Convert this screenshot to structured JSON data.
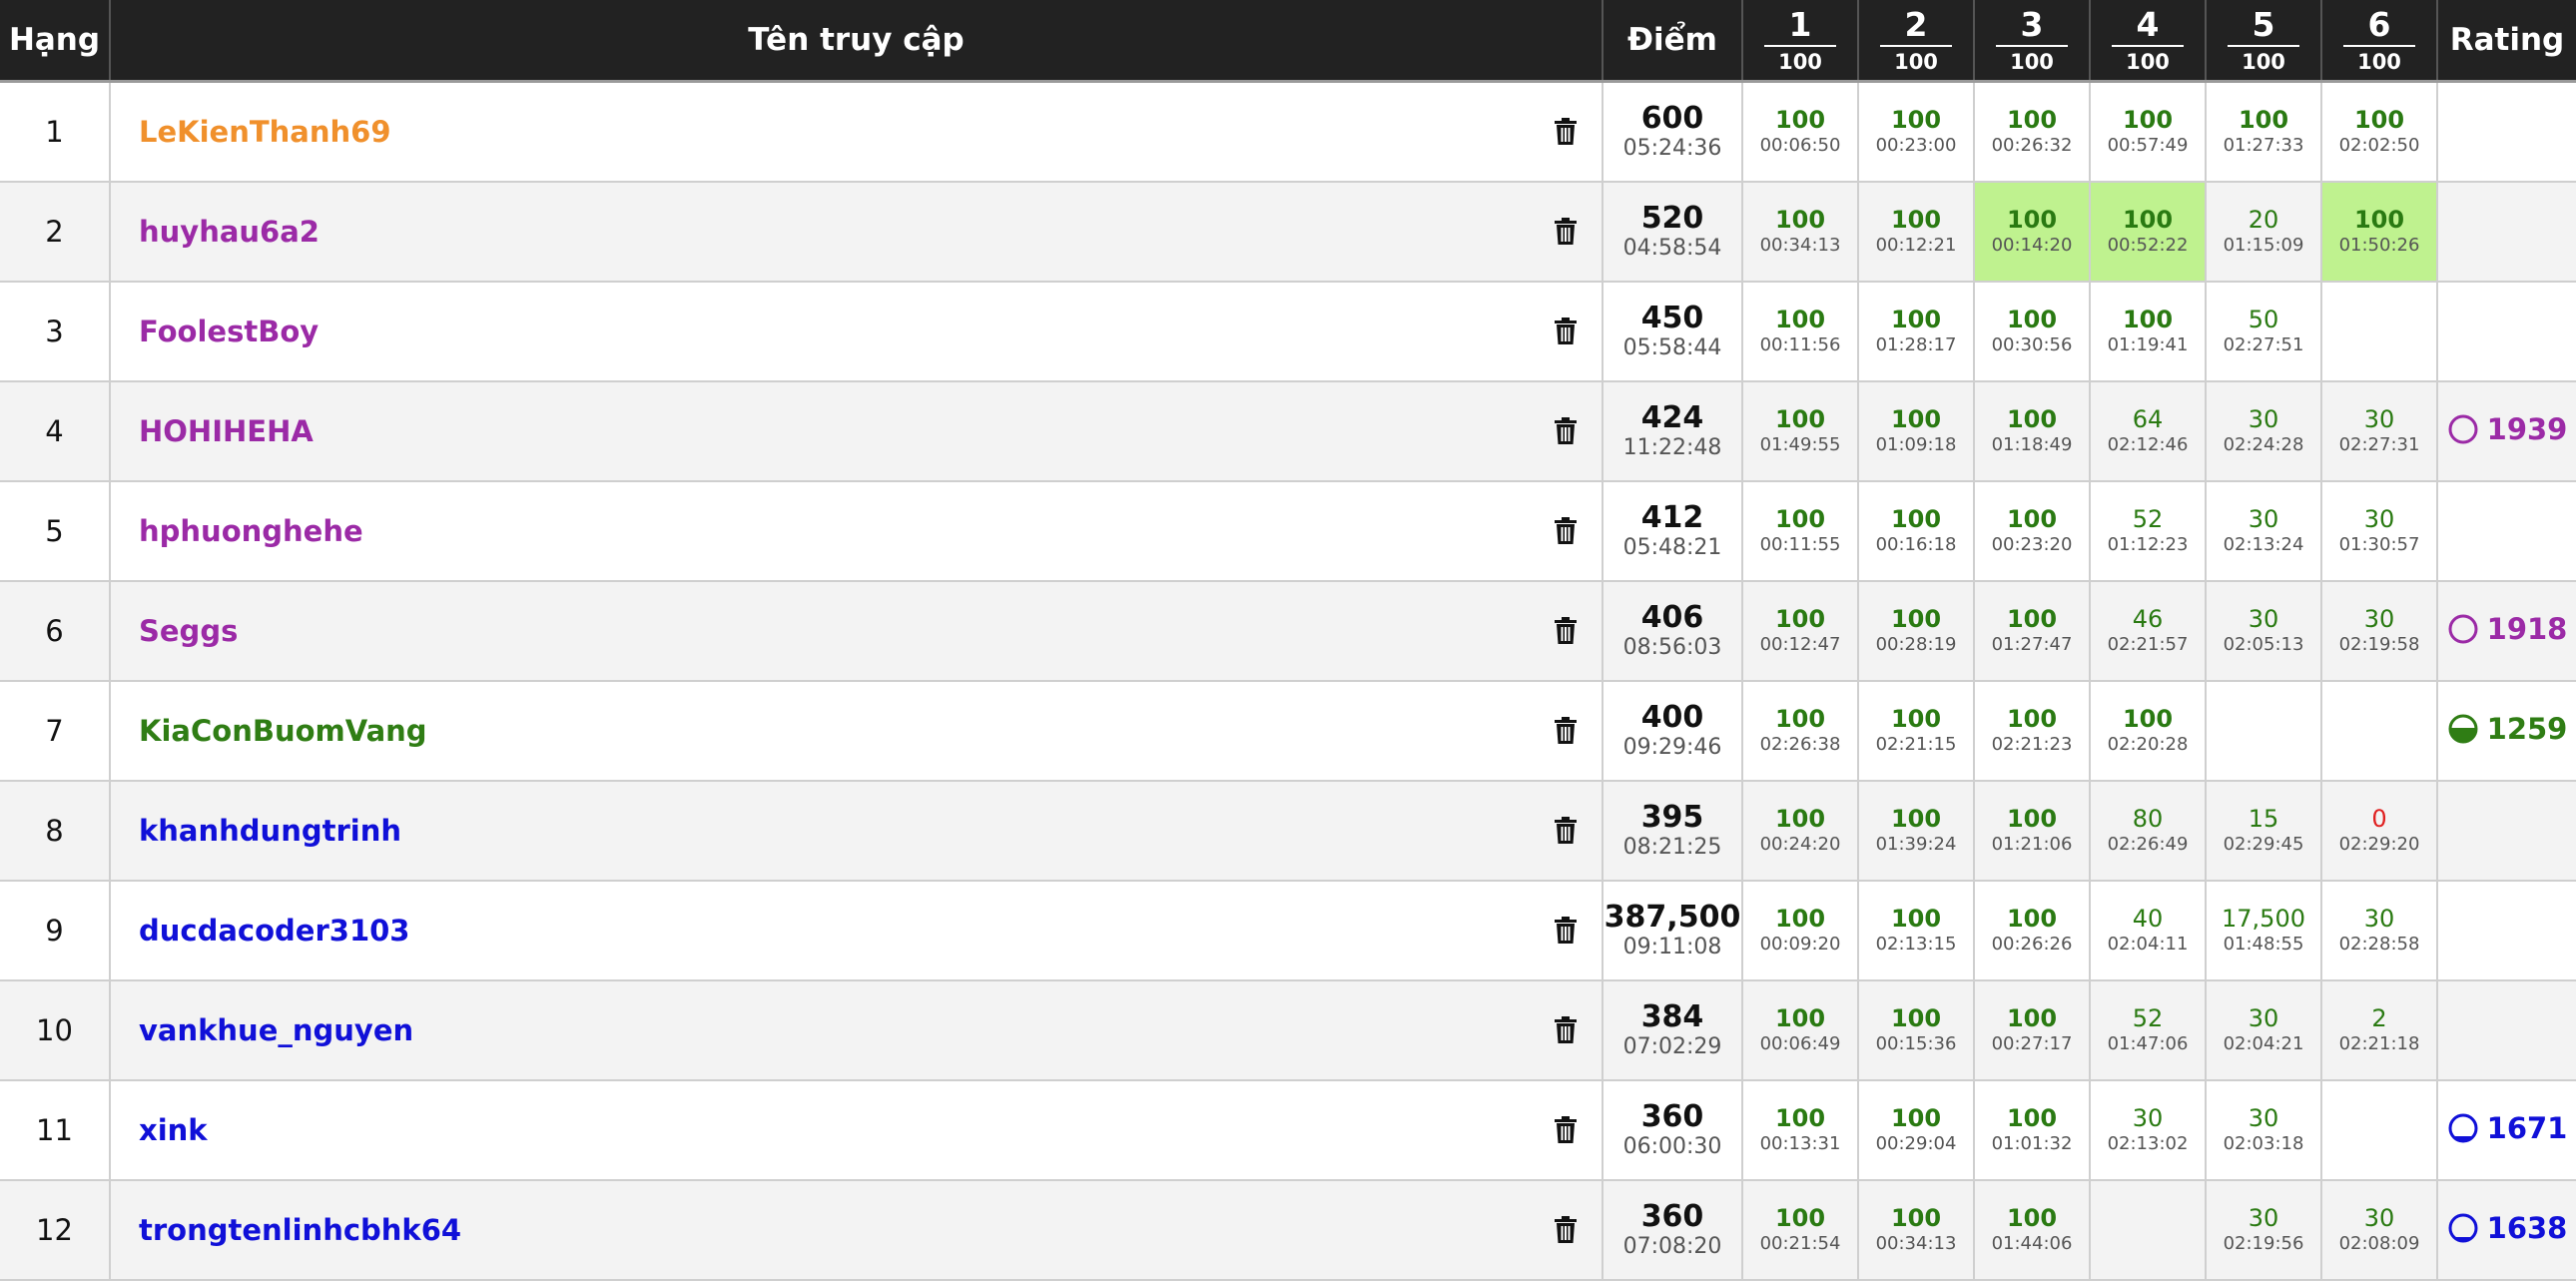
{
  "header": {
    "rank": "Hạng",
    "username": "Tên truy cập",
    "score": "Điểm",
    "rating": "Rating",
    "problems": [
      {
        "num": "1",
        "max": "100"
      },
      {
        "num": "2",
        "max": "100"
      },
      {
        "num": "3",
        "max": "100"
      },
      {
        "num": "4",
        "max": "100"
      },
      {
        "num": "5",
        "max": "100"
      },
      {
        "num": "6",
        "max": "100"
      }
    ]
  },
  "colors": {
    "header_bg": "#222222",
    "full_score": "#2a7a12",
    "zero_score": "#e02020",
    "first_solve_bg": "#bff28f",
    "user_orange": "#f0902c",
    "user_purple": "#9b2aa6",
    "user_green": "#2f7d14",
    "user_blue": "#1010d8",
    "row_alt_bg": "#f3f3f3"
  },
  "icons": {
    "delete": "trash-icon",
    "rating": "rating-circle-icon"
  },
  "rows": [
    {
      "rank": "1",
      "user": "LeKienThanh69",
      "user_color": "#f0902c",
      "points": "600",
      "time": "05:24:36",
      "problems": [
        {
          "s": "100",
          "t": "00:06:50"
        },
        {
          "s": "100",
          "t": "00:23:00"
        },
        {
          "s": "100",
          "t": "00:26:32"
        },
        {
          "s": "100",
          "t": "00:57:49"
        },
        {
          "s": "100",
          "t": "01:27:33"
        },
        {
          "s": "100",
          "t": "02:02:50"
        }
      ],
      "rating": null
    },
    {
      "rank": "2",
      "user": "huyhau6a2",
      "user_color": "#9b2aa6",
      "points": "520",
      "time": "04:58:54",
      "problems": [
        {
          "s": "100",
          "t": "00:34:13"
        },
        {
          "s": "100",
          "t": "00:12:21"
        },
        {
          "s": "100",
          "t": "00:14:20",
          "first": true
        },
        {
          "s": "100",
          "t": "00:52:22",
          "first": true
        },
        {
          "s": "20",
          "t": "01:15:09"
        },
        {
          "s": "100",
          "t": "01:50:26",
          "first": true
        }
      ],
      "rating": null
    },
    {
      "rank": "3",
      "user": "FoolestBoy",
      "user_color": "#9b2aa6",
      "points": "450",
      "time": "05:58:44",
      "problems": [
        {
          "s": "100",
          "t": "00:11:56"
        },
        {
          "s": "100",
          "t": "01:28:17"
        },
        {
          "s": "100",
          "t": "00:30:56"
        },
        {
          "s": "100",
          "t": "01:19:41"
        },
        {
          "s": "50",
          "t": "02:27:51"
        },
        null
      ],
      "rating": null
    },
    {
      "rank": "4",
      "user": "HOHIHEHA",
      "user_color": "#9b2aa6",
      "points": "424",
      "time": "11:22:48",
      "problems": [
        {
          "s": "100",
          "t": "01:49:55"
        },
        {
          "s": "100",
          "t": "01:09:18"
        },
        {
          "s": "100",
          "t": "01:18:49"
        },
        {
          "s": "64",
          "t": "02:12:46"
        },
        {
          "s": "30",
          "t": "02:24:28"
        },
        {
          "s": "30",
          "t": "02:27:31"
        }
      ],
      "rating": {
        "value": "1939",
        "color": "#9b2aa6",
        "fill": 0.05
      }
    },
    {
      "rank": "5",
      "user": "hphuonghehe",
      "user_color": "#9b2aa6",
      "points": "412",
      "time": "05:48:21",
      "problems": [
        {
          "s": "100",
          "t": "00:11:55"
        },
        {
          "s": "100",
          "t": "00:16:18"
        },
        {
          "s": "100",
          "t": "00:23:20"
        },
        {
          "s": "52",
          "t": "01:12:23"
        },
        {
          "s": "30",
          "t": "02:13:24"
        },
        {
          "s": "30",
          "t": "01:30:57"
        }
      ],
      "rating": null
    },
    {
      "rank": "6",
      "user": "Seggs",
      "user_color": "#9b2aa6",
      "points": "406",
      "time": "08:56:03",
      "problems": [
        {
          "s": "100",
          "t": "00:12:47"
        },
        {
          "s": "100",
          "t": "00:28:19"
        },
        {
          "s": "100",
          "t": "01:27:47"
        },
        {
          "s": "46",
          "t": "02:21:57"
        },
        {
          "s": "30",
          "t": "02:05:13"
        },
        {
          "s": "30",
          "t": "02:19:58"
        }
      ],
      "rating": {
        "value": "1918",
        "color": "#9b2aa6",
        "fill": 0.03
      }
    },
    {
      "rank": "7",
      "user": "KiaConBuomVang",
      "user_color": "#2f7d14",
      "points": "400",
      "time": "09:29:46",
      "problems": [
        {
          "s": "100",
          "t": "02:26:38"
        },
        {
          "s": "100",
          "t": "02:21:15"
        },
        {
          "s": "100",
          "t": "02:21:23"
        },
        {
          "s": "100",
          "t": "02:20:28"
        },
        null,
        null
      ],
      "rating": {
        "value": "1259",
        "color": "#2f7d14",
        "fill": 0.55
      }
    },
    {
      "rank": "8",
      "user": "khanhdungtrinh",
      "user_color": "#1010d8",
      "points": "395",
      "time": "08:21:25",
      "problems": [
        {
          "s": "100",
          "t": "00:24:20"
        },
        {
          "s": "100",
          "t": "01:39:24"
        },
        {
          "s": "100",
          "t": "01:21:06"
        },
        {
          "s": "80",
          "t": "02:26:49"
        },
        {
          "s": "15",
          "t": "02:29:45"
        },
        {
          "s": "0",
          "t": "02:29:20"
        }
      ],
      "rating": null
    },
    {
      "rank": "9",
      "user": "ducdacoder3103",
      "user_color": "#1010d8",
      "points": "387,500",
      "time": "09:11:08",
      "problems": [
        {
          "s": "100",
          "t": "00:09:20"
        },
        {
          "s": "100",
          "t": "02:13:15"
        },
        {
          "s": "100",
          "t": "00:26:26"
        },
        {
          "s": "40",
          "t": "02:04:11"
        },
        {
          "s": "17,500",
          "t": "01:48:55"
        },
        {
          "s": "30",
          "t": "02:28:58"
        }
      ],
      "rating": null
    },
    {
      "rank": "10",
      "user": "vankhue_nguyen",
      "user_color": "#1010d8",
      "points": "384",
      "time": "07:02:29",
      "problems": [
        {
          "s": "100",
          "t": "00:06:49"
        },
        {
          "s": "100",
          "t": "00:15:36"
        },
        {
          "s": "100",
          "t": "00:27:17"
        },
        {
          "s": "52",
          "t": "01:47:06"
        },
        {
          "s": "30",
          "t": "02:04:21"
        },
        {
          "s": "2",
          "t": "02:21:18"
        }
      ],
      "rating": null
    },
    {
      "rank": "11",
      "user": "xink",
      "user_color": "#1010d8",
      "points": "360",
      "time": "06:00:30",
      "problems": [
        {
          "s": "100",
          "t": "00:13:31"
        },
        {
          "s": "100",
          "t": "00:29:04"
        },
        {
          "s": "100",
          "t": "01:01:32"
        },
        {
          "s": "30",
          "t": "02:13:02"
        },
        {
          "s": "30",
          "t": "02:03:18"
        },
        null
      ],
      "rating": {
        "value": "1671",
        "color": "#1010d8",
        "fill": 0.2
      }
    },
    {
      "rank": "12",
      "user": "trongtenlinhcbhk64",
      "user_color": "#1010d8",
      "points": "360",
      "time": "07:08:20",
      "problems": [
        {
          "s": "100",
          "t": "00:21:54"
        },
        {
          "s": "100",
          "t": "00:34:13"
        },
        {
          "s": "100",
          "t": "01:44:06"
        },
        null,
        {
          "s": "30",
          "t": "02:19:56"
        },
        {
          "s": "30",
          "t": "02:08:09"
        }
      ],
      "rating": {
        "value": "1638",
        "color": "#1010d8",
        "fill": 0.15
      }
    }
  ]
}
